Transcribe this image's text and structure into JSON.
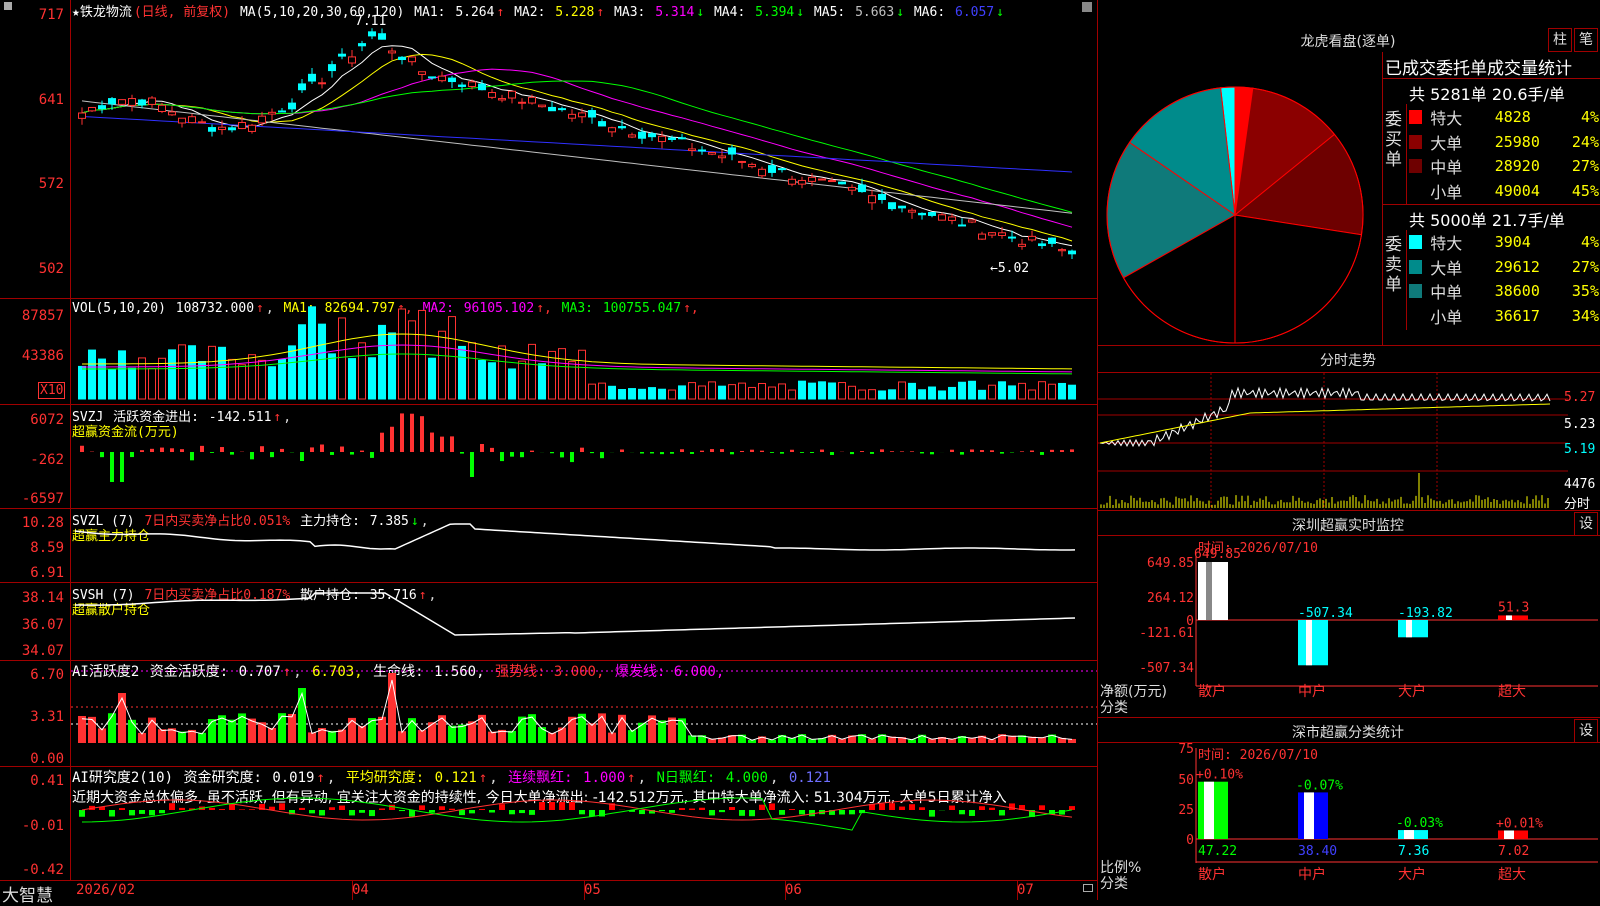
{
  "stock": {
    "title": "★铁龙物流",
    "period": "(日线, 前复权)",
    "ma_header": "MA(5,10,20,30,60,120)",
    "ma": [
      {
        "label": "MA1:",
        "value": "5.264",
        "arrow": "↑",
        "color": "#ffffff"
      },
      {
        "label": "MA2:",
        "value": "5.228",
        "arrow": "↑",
        "color": "#ffff00"
      },
      {
        "label": "MA3:",
        "value": "5.314",
        "arrow": "↓",
        "color": "#ff00ff"
      },
      {
        "label": "MA4:",
        "value": "5.394",
        "arrow": "↓",
        "color": "#00ff00"
      },
      {
        "label": "MA5:",
        "value": "5.663",
        "arrow": "↓",
        "color": "#c0c0c0"
      },
      {
        "label": "MA6:",
        "value": "6.057",
        "arrow": "↓",
        "color": "#4040ff"
      }
    ],
    "price_axis": [
      "717",
      "641",
      "572",
      "502"
    ],
    "high_marker": "7.11",
    "low_marker": "←5.02"
  },
  "vol": {
    "header": "VOL(5,10,20)",
    "value": "108732.000",
    "ma": [
      {
        "label": "MA1:",
        "value": "82694.797",
        "color": "#ffff00"
      },
      {
        "label": "MA2:",
        "value": "96105.102",
        "color": "#ff00ff"
      },
      {
        "label": "MA3:",
        "value": "100755.047",
        "color": "#00ff00"
      }
    ],
    "axis": [
      "87857",
      "43386"
    ],
    "unit": "X10"
  },
  "svzj": {
    "header": "SVZJ",
    "label": "活跃资金进出:",
    "value": "-142.511",
    "sub": "超赢资金流(万元)",
    "axis": [
      "6072",
      "-262",
      "-6597"
    ]
  },
  "svzl": {
    "header": "SVZL (7)",
    "label1": "7日内买卖净占比0.051%",
    "label2": "主力持仓:",
    "value": "7.385",
    "sub": "超赢主力持仓",
    "axis": [
      "10.28",
      "8.59",
      "6.91"
    ]
  },
  "svsh": {
    "header": "SVSH (7)",
    "label1": "7日内买卖净占比0.187%",
    "label2": "散户持仓:",
    "value": "35.716",
    "sub": "超赢散户持仓",
    "axis": [
      "38.14",
      "36.07",
      "34.07"
    ]
  },
  "ai1": {
    "header": "AI活跃度2",
    "label": "资金活跃度:",
    "value": "0.707",
    "v2": "6.703,",
    "life": "生命线:",
    "life_v": "1.560,",
    "strong": "强势线: 3.000,",
    "burst": "爆发线: 6.000,",
    "axis": [
      "6.70",
      "3.31",
      "0.00"
    ]
  },
  "ai2": {
    "header": "AI研究度2(10)",
    "l1": "资金研究度:",
    "v1": "0.019",
    "l2": "平均研究度:",
    "v2": "0.121",
    "l3": "连续飘红:",
    "v3": "1.000",
    "l4": "N日飘红:",
    "v4": "4.000",
    "v5": "0.121",
    "comment": "近期大资金总体偏多, 虽不活跃, 但有异动, 宜关注大资金的持续性, 今日大单净流出: -142.512万元, 其中特大单净流入: 51.304万元, 大单5日累计净入",
    "axis": [
      "0.41",
      "-0.01",
      "-0.42"
    ]
  },
  "timeline": {
    "brand": "大智慧",
    "dates": [
      "2026/02",
      "04",
      "05",
      "06",
      "07"
    ]
  },
  "dragon": {
    "title": "龙虎看盘(逐单)",
    "btn1": "柱",
    "btn2": "笔",
    "table_title": "已成交委托单成交量统计",
    "buy": {
      "side": "委买单",
      "summary": "共 5281单 20.6手/单",
      "rows": [
        {
          "label": "特大",
          "value": "4828",
          "pct": "4%",
          "color": "#ff0000"
        },
        {
          "label": "大单",
          "value": "25980",
          "pct": "24%",
          "color": "#8b0000"
        },
        {
          "label": "中单",
          "value": "28920",
          "pct": "27%",
          "color": "#6e0000"
        },
        {
          "label": "小单",
          "value": "49004",
          "pct": "45%",
          "color": "#000000"
        }
      ]
    },
    "sell": {
      "side": "委卖单",
      "summary": "共 5000单 21.7手/单",
      "rows": [
        {
          "label": "特大",
          "value": "3904",
          "pct": "4%",
          "color": "#00ffff"
        },
        {
          "label": "大单",
          "value": "29612",
          "pct": "27%",
          "color": "#008b8b"
        },
        {
          "label": "中单",
          "value": "38600",
          "pct": "35%",
          "color": "#0f7a7a"
        },
        {
          "label": "小单",
          "value": "36617",
          "pct": "34%",
          "color": "#000000"
        }
      ]
    }
  },
  "intraday": {
    "title": "分时走势",
    "axis": [
      "5.27",
      "5.23",
      "5.19"
    ],
    "vol_max": "4476",
    "vol_label": "分时"
  },
  "sz_monitor": {
    "title": "深圳超赢实时监控",
    "btn": "设",
    "time": "时间: 2026/07/10",
    "axis": [
      "649.85",
      "264.12",
      "0",
      "-121.61",
      "-507.34"
    ],
    "ylabel": "净额(万元)",
    "xlabel": "分类",
    "bars": [
      {
        "cat": "散户",
        "value": "649.85"
      },
      {
        "cat": "中户",
        "value": "-507.34"
      },
      {
        "cat": "大户",
        "value": "-193.82"
      },
      {
        "cat": "超大",
        "value": "51.3"
      }
    ]
  },
  "sz_classify": {
    "title": "深市超赢分类统计",
    "btn": "设",
    "time": "时间: 2026/07/10",
    "axis": [
      "75",
      "50",
      "25",
      "0"
    ],
    "ylabel": "比例%",
    "xlabel": "分类",
    "bars": [
      {
        "cat": "散户",
        "value": "47.22",
        "delta": "+0.10%"
      },
      {
        "cat": "中户",
        "value": "38.40",
        "delta": "-0.07%"
      },
      {
        "cat": "大户",
        "value": "7.36",
        "delta": "-0.03%"
      },
      {
        "cat": "超大",
        "value": "7.02",
        "delta": "+0.01%"
      }
    ]
  },
  "chart_data": {
    "type": "pie",
    "title": "龙虎看盘(逐单)",
    "categories": [
      "委买特大",
      "委买大单",
      "委买中单",
      "委买小单",
      "委卖特大",
      "委卖大单",
      "委卖中单",
      "委卖小单"
    ],
    "values": [
      4828,
      25980,
      28920,
      49004,
      3904,
      29612,
      38600,
      36617
    ]
  }
}
